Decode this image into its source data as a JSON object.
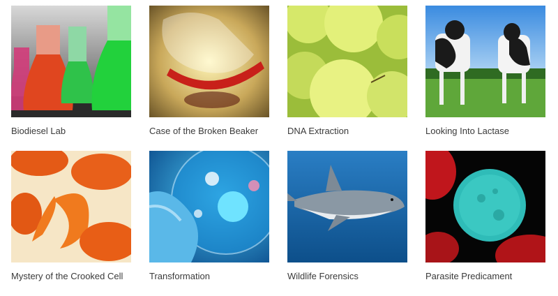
{
  "courses": [
    {
      "title": "Biodiesel Lab",
      "image": "colored-flasks-image"
    },
    {
      "title": "Case of the Broken Beaker",
      "image": "broken-beaker-image"
    },
    {
      "title": "DNA Extraction",
      "image": "green-apples-image"
    },
    {
      "title": "Looking Into Lactase",
      "image": "cows-in-field-image"
    },
    {
      "title": "Mystery of the Crooked Cell",
      "image": "sickle-cell-image"
    },
    {
      "title": "Transformation",
      "image": "petri-dish-image"
    },
    {
      "title": "Wildlife Forensics",
      "image": "shark-image"
    },
    {
      "title": "Parasite Predicament",
      "image": "parasite-cell-image"
    }
  ]
}
